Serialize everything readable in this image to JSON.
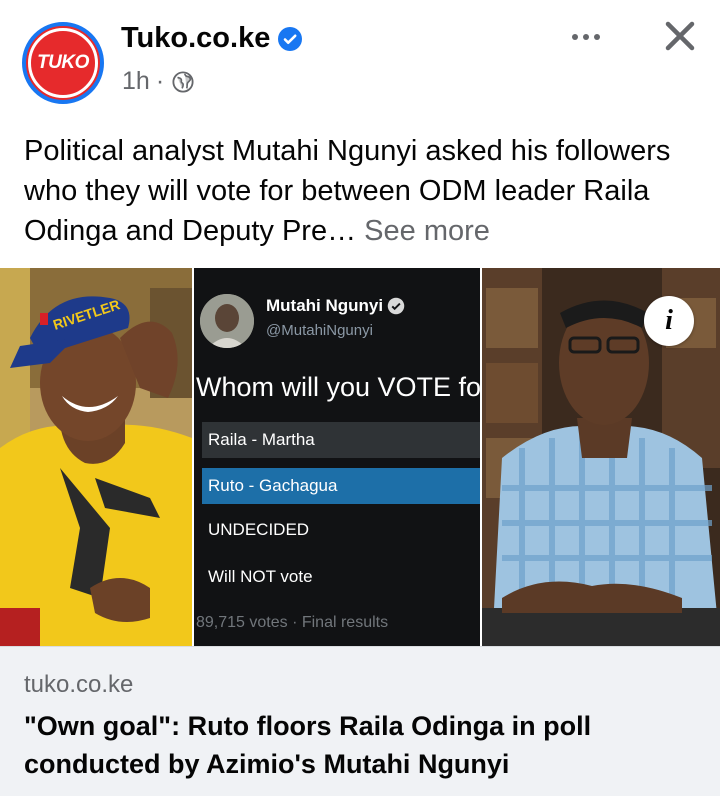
{
  "post": {
    "page_name": "Tuko.co.ke",
    "avatar_text": "TUKO",
    "time_ago": "1h",
    "meta_separator": "·",
    "caption": "Political analyst Mutahi Ngunyi asked his followers who they will vote for between ODM leader Raila Odinga and Deputy Pre…",
    "see_more_label": "See more",
    "icons": {
      "verified": "verified-badge-icon",
      "audience": "globe-icon",
      "more": "more-options-icon",
      "close": "close-icon",
      "info": "info-icon"
    },
    "colors": {
      "brand_red": "#e62a2c",
      "verified_blue": "#1877f2",
      "secondary_text": "#65676b",
      "link_background": "#f0f2f5"
    }
  },
  "image": {
    "left_cap_text": "RIVETLER",
    "tweet": {
      "name": "Mutahi Ngunyi",
      "handle": "@MutahiNgunyi",
      "question": "Whom will you VOTE fo",
      "options": [
        "Raila - Martha",
        "Ruto - Gachagua",
        "UNDECIDED",
        "Will NOT vote"
      ],
      "footer": "89,715 votes · Final results"
    },
    "info_glyph": "i"
  },
  "link_preview": {
    "domain": "tuko.co.ke",
    "title": "\"Own goal\": Ruto floors Raila Odinga in poll conducted by Azimio's Mutahi Ngunyi"
  }
}
